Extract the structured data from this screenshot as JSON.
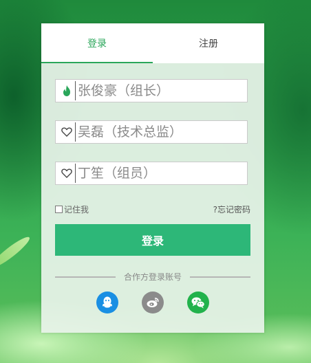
{
  "tabs": {
    "login_label": "登录",
    "register_label": "注册"
  },
  "fields": [
    {
      "placeholder": "张俊豪（组长）",
      "icon": "flame-icon",
      "icon_color": "#2aa65a"
    },
    {
      "placeholder": "吴磊（技术总监）",
      "icon": "heart-icon",
      "icon_color": "#444444"
    },
    {
      "placeholder": "丁笙（组员）",
      "icon": "heart-icon",
      "icon_color": "#444444"
    }
  ],
  "options": {
    "remember_label": "记住我",
    "forgot_label": "?忘记密码"
  },
  "login_button_label": "登录",
  "partner": {
    "label": "合作方登录账号",
    "icons": [
      "qq-icon",
      "weibo-icon",
      "wechat-icon"
    ]
  },
  "colors": {
    "accent": "#2aa65a",
    "button": "#2db778",
    "qq": "#1a8fe3",
    "weibo": "#8b8b8b",
    "wechat": "#22b24c"
  }
}
